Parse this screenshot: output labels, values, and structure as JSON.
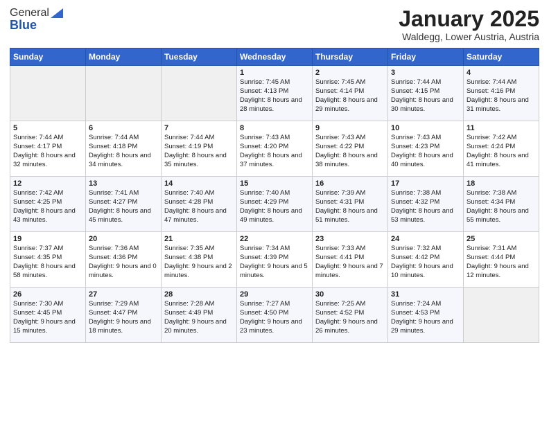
{
  "logo": {
    "general": "General",
    "blue": "Blue"
  },
  "title": "January 2025",
  "location": "Waldegg, Lower Austria, Austria",
  "days_of_week": [
    "Sunday",
    "Monday",
    "Tuesday",
    "Wednesday",
    "Thursday",
    "Friday",
    "Saturday"
  ],
  "weeks": [
    [
      {
        "day": "",
        "sunrise": "",
        "sunset": "",
        "daylight": ""
      },
      {
        "day": "",
        "sunrise": "",
        "sunset": "",
        "daylight": ""
      },
      {
        "day": "",
        "sunrise": "",
        "sunset": "",
        "daylight": ""
      },
      {
        "day": "1",
        "sunrise": "Sunrise: 7:45 AM",
        "sunset": "Sunset: 4:13 PM",
        "daylight": "Daylight: 8 hours and 28 minutes."
      },
      {
        "day": "2",
        "sunrise": "Sunrise: 7:45 AM",
        "sunset": "Sunset: 4:14 PM",
        "daylight": "Daylight: 8 hours and 29 minutes."
      },
      {
        "day": "3",
        "sunrise": "Sunrise: 7:44 AM",
        "sunset": "Sunset: 4:15 PM",
        "daylight": "Daylight: 8 hours and 30 minutes."
      },
      {
        "day": "4",
        "sunrise": "Sunrise: 7:44 AM",
        "sunset": "Sunset: 4:16 PM",
        "daylight": "Daylight: 8 hours and 31 minutes."
      }
    ],
    [
      {
        "day": "5",
        "sunrise": "Sunrise: 7:44 AM",
        "sunset": "Sunset: 4:17 PM",
        "daylight": "Daylight: 8 hours and 32 minutes."
      },
      {
        "day": "6",
        "sunrise": "Sunrise: 7:44 AM",
        "sunset": "Sunset: 4:18 PM",
        "daylight": "Daylight: 8 hours and 34 minutes."
      },
      {
        "day": "7",
        "sunrise": "Sunrise: 7:44 AM",
        "sunset": "Sunset: 4:19 PM",
        "daylight": "Daylight: 8 hours and 35 minutes."
      },
      {
        "day": "8",
        "sunrise": "Sunrise: 7:43 AM",
        "sunset": "Sunset: 4:20 PM",
        "daylight": "Daylight: 8 hours and 37 minutes."
      },
      {
        "day": "9",
        "sunrise": "Sunrise: 7:43 AM",
        "sunset": "Sunset: 4:22 PM",
        "daylight": "Daylight: 8 hours and 38 minutes."
      },
      {
        "day": "10",
        "sunrise": "Sunrise: 7:43 AM",
        "sunset": "Sunset: 4:23 PM",
        "daylight": "Daylight: 8 hours and 40 minutes."
      },
      {
        "day": "11",
        "sunrise": "Sunrise: 7:42 AM",
        "sunset": "Sunset: 4:24 PM",
        "daylight": "Daylight: 8 hours and 41 minutes."
      }
    ],
    [
      {
        "day": "12",
        "sunrise": "Sunrise: 7:42 AM",
        "sunset": "Sunset: 4:25 PM",
        "daylight": "Daylight: 8 hours and 43 minutes."
      },
      {
        "day": "13",
        "sunrise": "Sunrise: 7:41 AM",
        "sunset": "Sunset: 4:27 PM",
        "daylight": "Daylight: 8 hours and 45 minutes."
      },
      {
        "day": "14",
        "sunrise": "Sunrise: 7:40 AM",
        "sunset": "Sunset: 4:28 PM",
        "daylight": "Daylight: 8 hours and 47 minutes."
      },
      {
        "day": "15",
        "sunrise": "Sunrise: 7:40 AM",
        "sunset": "Sunset: 4:29 PM",
        "daylight": "Daylight: 8 hours and 49 minutes."
      },
      {
        "day": "16",
        "sunrise": "Sunrise: 7:39 AM",
        "sunset": "Sunset: 4:31 PM",
        "daylight": "Daylight: 8 hours and 51 minutes."
      },
      {
        "day": "17",
        "sunrise": "Sunrise: 7:38 AM",
        "sunset": "Sunset: 4:32 PM",
        "daylight": "Daylight: 8 hours and 53 minutes."
      },
      {
        "day": "18",
        "sunrise": "Sunrise: 7:38 AM",
        "sunset": "Sunset: 4:34 PM",
        "daylight": "Daylight: 8 hours and 55 minutes."
      }
    ],
    [
      {
        "day": "19",
        "sunrise": "Sunrise: 7:37 AM",
        "sunset": "Sunset: 4:35 PM",
        "daylight": "Daylight: 8 hours and 58 minutes."
      },
      {
        "day": "20",
        "sunrise": "Sunrise: 7:36 AM",
        "sunset": "Sunset: 4:36 PM",
        "daylight": "Daylight: 9 hours and 0 minutes."
      },
      {
        "day": "21",
        "sunrise": "Sunrise: 7:35 AM",
        "sunset": "Sunset: 4:38 PM",
        "daylight": "Daylight: 9 hours and 2 minutes."
      },
      {
        "day": "22",
        "sunrise": "Sunrise: 7:34 AM",
        "sunset": "Sunset: 4:39 PM",
        "daylight": "Daylight: 9 hours and 5 minutes."
      },
      {
        "day": "23",
        "sunrise": "Sunrise: 7:33 AM",
        "sunset": "Sunset: 4:41 PM",
        "daylight": "Daylight: 9 hours and 7 minutes."
      },
      {
        "day": "24",
        "sunrise": "Sunrise: 7:32 AM",
        "sunset": "Sunset: 4:42 PM",
        "daylight": "Daylight: 9 hours and 10 minutes."
      },
      {
        "day": "25",
        "sunrise": "Sunrise: 7:31 AM",
        "sunset": "Sunset: 4:44 PM",
        "daylight": "Daylight: 9 hours and 12 minutes."
      }
    ],
    [
      {
        "day": "26",
        "sunrise": "Sunrise: 7:30 AM",
        "sunset": "Sunset: 4:45 PM",
        "daylight": "Daylight: 9 hours and 15 minutes."
      },
      {
        "day": "27",
        "sunrise": "Sunrise: 7:29 AM",
        "sunset": "Sunset: 4:47 PM",
        "daylight": "Daylight: 9 hours and 18 minutes."
      },
      {
        "day": "28",
        "sunrise": "Sunrise: 7:28 AM",
        "sunset": "Sunset: 4:49 PM",
        "daylight": "Daylight: 9 hours and 20 minutes."
      },
      {
        "day": "29",
        "sunrise": "Sunrise: 7:27 AM",
        "sunset": "Sunset: 4:50 PM",
        "daylight": "Daylight: 9 hours and 23 minutes."
      },
      {
        "day": "30",
        "sunrise": "Sunrise: 7:25 AM",
        "sunset": "Sunset: 4:52 PM",
        "daylight": "Daylight: 9 hours and 26 minutes."
      },
      {
        "day": "31",
        "sunrise": "Sunrise: 7:24 AM",
        "sunset": "Sunset: 4:53 PM",
        "daylight": "Daylight: 9 hours and 29 minutes."
      },
      {
        "day": "",
        "sunrise": "",
        "sunset": "",
        "daylight": ""
      }
    ]
  ]
}
